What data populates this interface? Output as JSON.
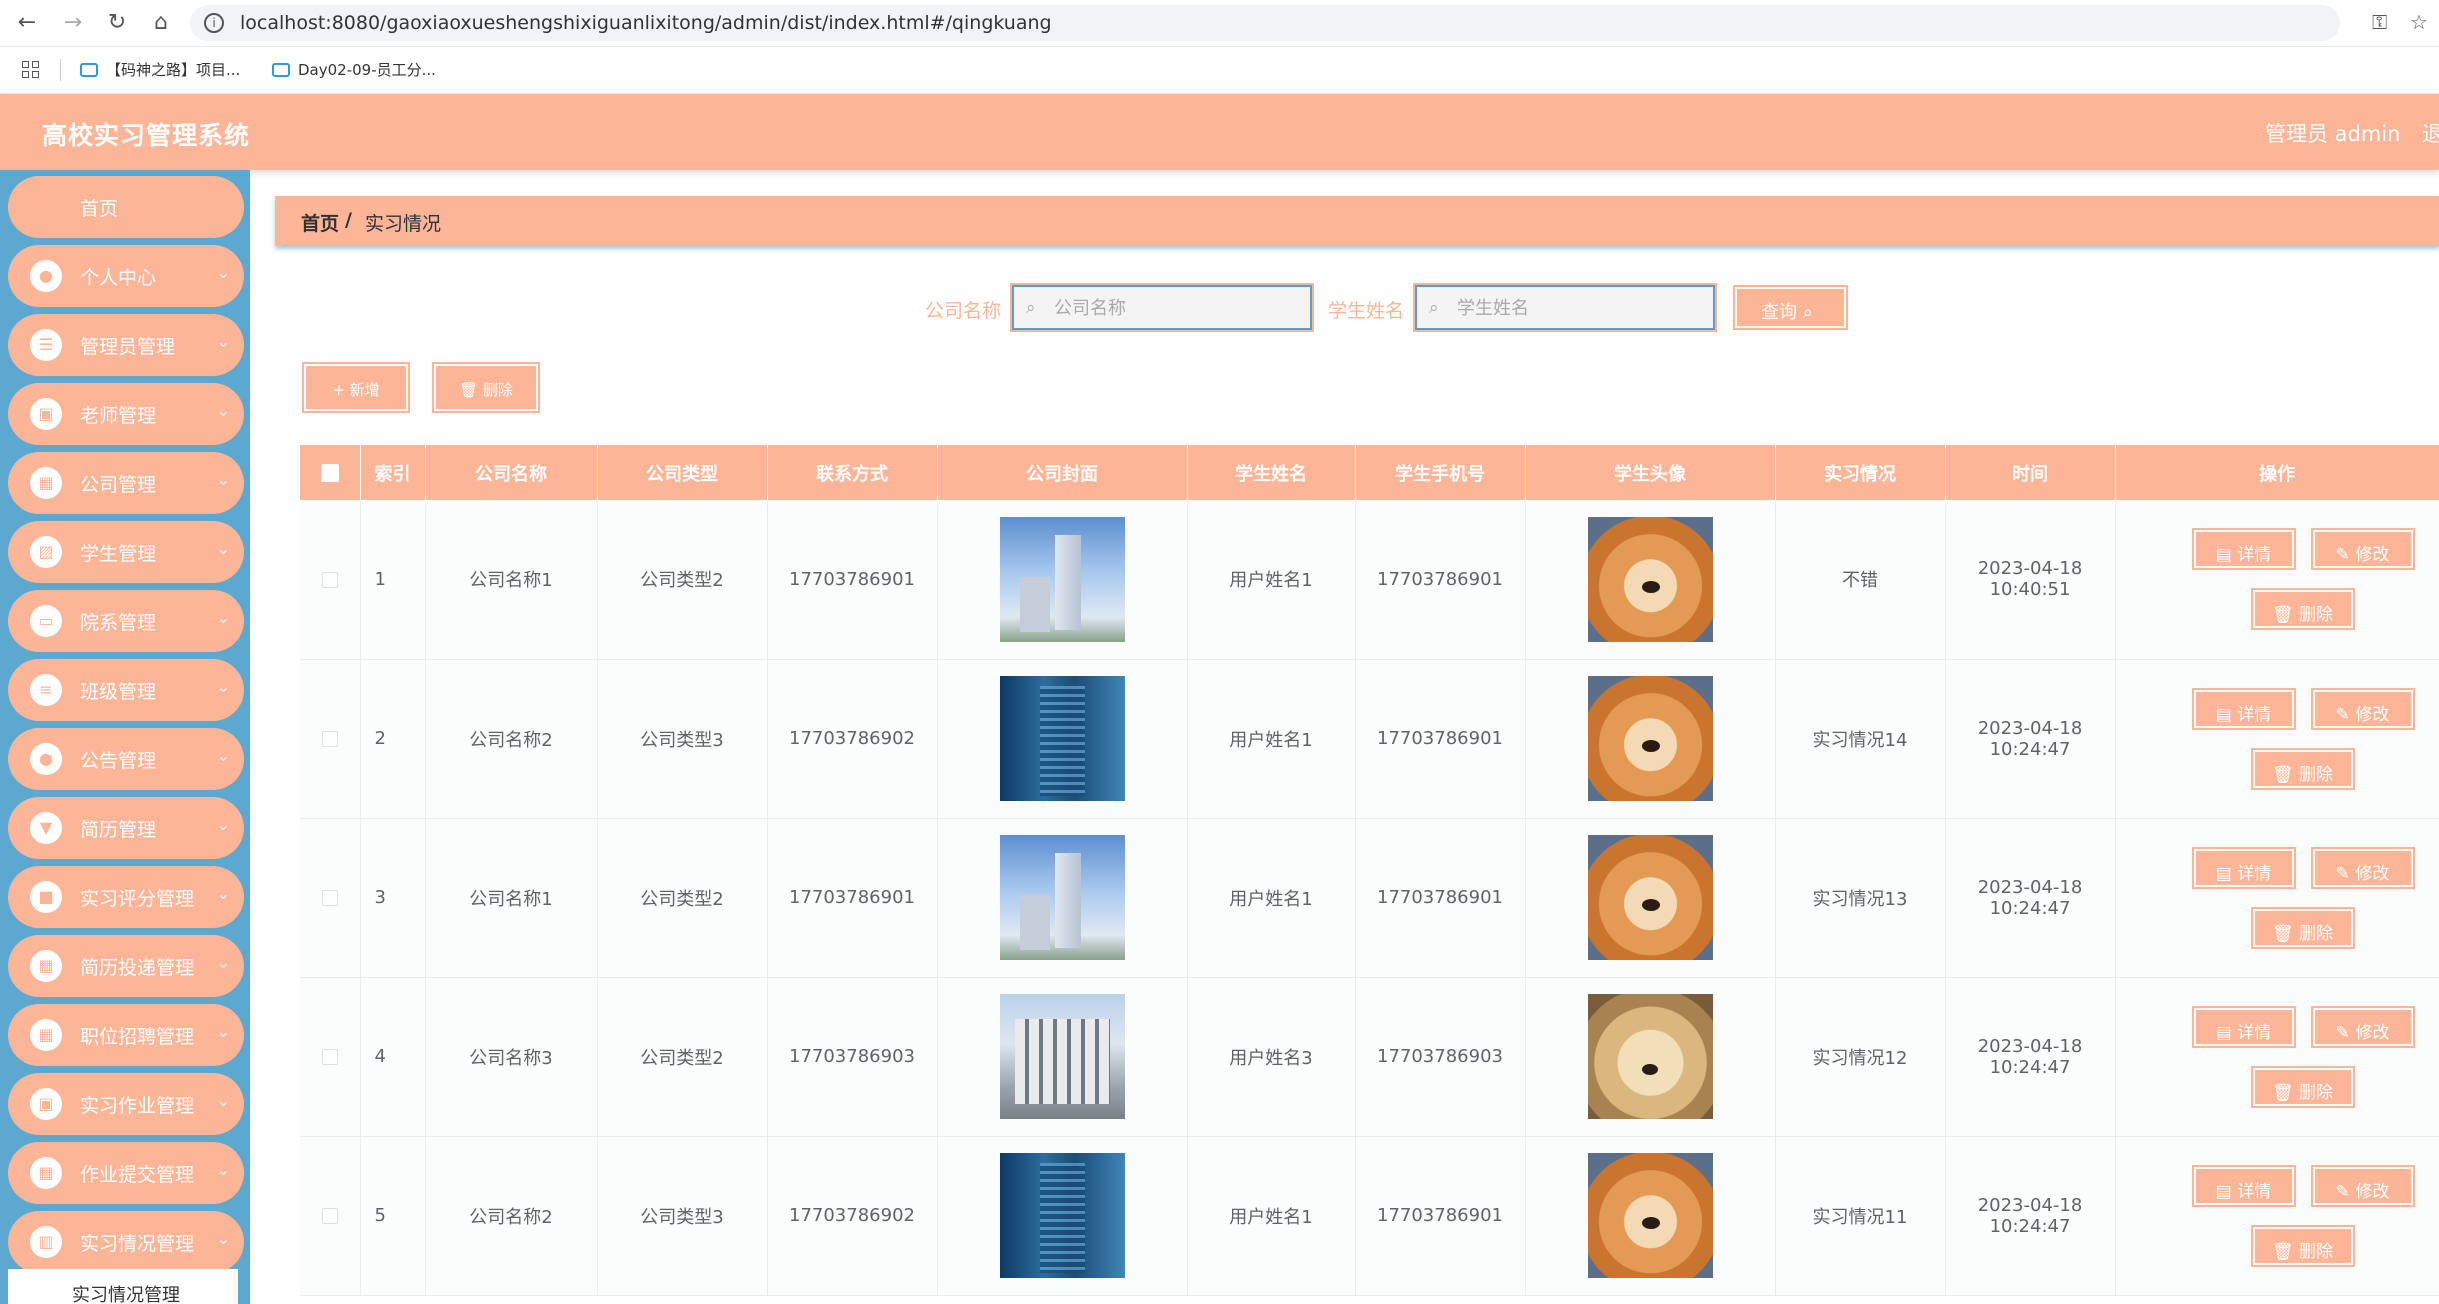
{
  "browser": {
    "url": "localhost:8080/gaoxiaoxueshengshixiguanlixitong/admin/dist/index.html#/qingkuang",
    "bookmarks": [
      "【码神之路】项目...",
      "Day02-09-员工分..."
    ]
  },
  "header": {
    "title": "高校实习管理系统",
    "user": "管理员 admin",
    "logout": "退"
  },
  "sidebar": {
    "items": [
      {
        "label": "首页",
        "icon": "home-icon"
      },
      {
        "label": "个人中心",
        "icon": "user-icon"
      },
      {
        "label": "管理员管理",
        "icon": "list-icon"
      },
      {
        "label": "老师管理",
        "icon": "clipboard-icon"
      },
      {
        "label": "公司管理",
        "icon": "grid-icon"
      },
      {
        "label": "学生管理",
        "icon": "image-icon"
      },
      {
        "label": "院系管理",
        "icon": "monitor-icon"
      },
      {
        "label": "班级管理",
        "icon": "sliders-icon"
      },
      {
        "label": "公告管理",
        "icon": "user-icon"
      },
      {
        "label": "简历管理",
        "icon": "megaphone-icon"
      },
      {
        "label": "实习评分管理",
        "icon": "chat-icon"
      },
      {
        "label": "简历投递管理",
        "icon": "grid-icon"
      },
      {
        "label": "职位招聘管理",
        "icon": "grid-icon"
      },
      {
        "label": "实习作业管理",
        "icon": "clipboard-icon"
      },
      {
        "label": "作业提交管理",
        "icon": "grid-icon"
      },
      {
        "label": "实习情况管理",
        "icon": "chart-icon"
      }
    ],
    "sub_item": "实习情况管理"
  },
  "breadcrumb": {
    "home": "首页",
    "separator": "/",
    "current": "实习情况"
  },
  "search": {
    "company_label": "公司名称",
    "company_placeholder": "公司名称",
    "student_label": "学生姓名",
    "student_placeholder": "学生姓名",
    "query_button": "查询 ⌕"
  },
  "actions": {
    "add": "+ 新增",
    "delete": "🗑 删除"
  },
  "table": {
    "columns": [
      "索引",
      "公司名称",
      "公司类型",
      "联系方式",
      "公司封面",
      "学生姓名",
      "学生手机号",
      "学生头像",
      "实习情况",
      "时间",
      "操作"
    ],
    "rows": [
      {
        "index": "1",
        "company": "公司名称1",
        "type": "公司类型2",
        "contact": "17703786901",
        "cover": "building-a",
        "student": "用户姓名1",
        "phone": "17703786901",
        "avatar": "shiba-dog",
        "status": "不错",
        "time": "2023-04-18 10:40:51"
      },
      {
        "index": "2",
        "company": "公司名称2",
        "type": "公司类型3",
        "contact": "17703786902",
        "cover": "building-b",
        "student": "用户姓名1",
        "phone": "17703786901",
        "avatar": "shiba-dog",
        "status": "实习情况14",
        "time": "2023-04-18 10:24:47"
      },
      {
        "index": "3",
        "company": "公司名称1",
        "type": "公司类型2",
        "contact": "17703786901",
        "cover": "building-a",
        "student": "用户姓名1",
        "phone": "17703786901",
        "avatar": "shiba-dog",
        "status": "实习情况13",
        "time": "2023-04-18 10:24:47"
      },
      {
        "index": "4",
        "company": "公司名称3",
        "type": "公司类型2",
        "contact": "17703786903",
        "cover": "building-c",
        "student": "用户姓名3",
        "phone": "17703786903",
        "avatar": "puppy",
        "status": "实习情况12",
        "time": "2023-04-18 10:24:47"
      },
      {
        "index": "5",
        "company": "公司名称2",
        "type": "公司类型3",
        "contact": "17703786902",
        "cover": "building-b",
        "student": "用户姓名1",
        "phone": "17703786901",
        "avatar": "shiba-dog",
        "status": "实习情况11",
        "time": "2023-04-18 10:24:47"
      }
    ],
    "row_actions": {
      "detail": "▤ 详情",
      "edit": "✎ 修改",
      "delete": "🗑 删除"
    }
  },
  "colors": {
    "accent": "#fdb597",
    "sidebar": "#5da8cf",
    "border_blue": "#54a0d0"
  }
}
